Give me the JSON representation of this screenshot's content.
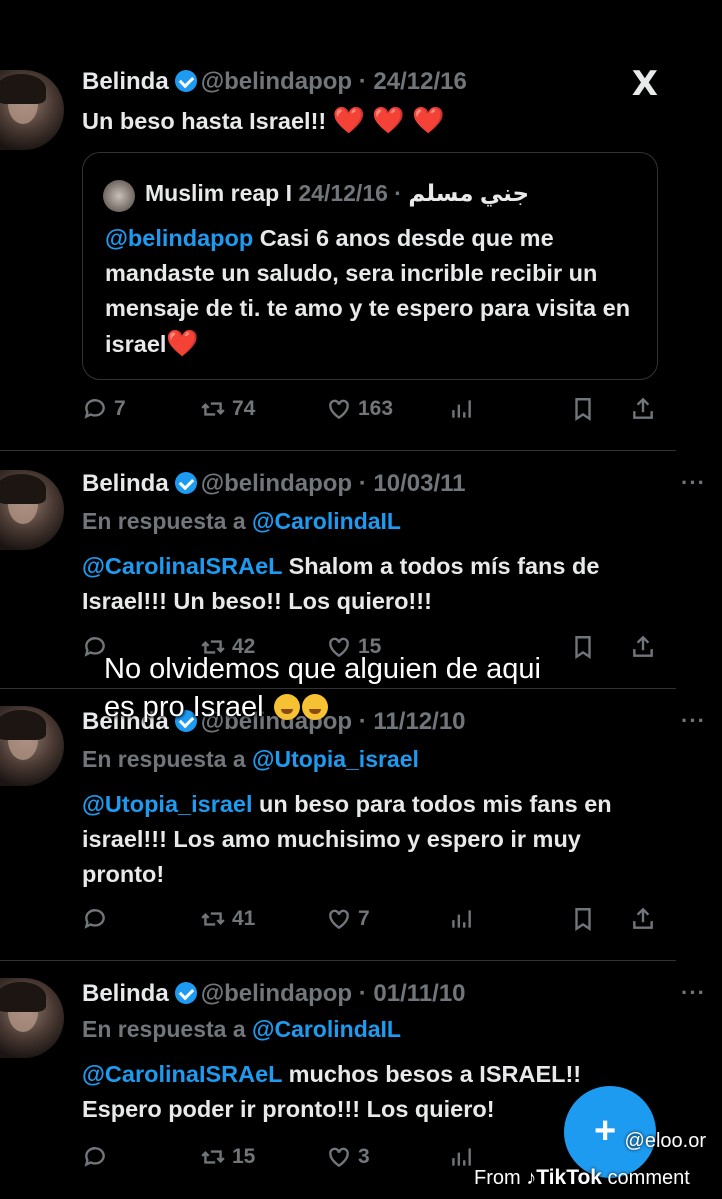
{
  "app": {
    "logo": "X"
  },
  "tweets": [
    {
      "name": "Belinda",
      "handle": "@belindapop",
      "date": "24/12/16",
      "text": "Un beso hasta Israel!!",
      "quote": {
        "name": "Muslim reap I جني مسلم",
        "date": "24/12/16",
        "mention": "@belindapop",
        "text": " Casi 6 anos desde que me mandaste un saludo, sera incrible recibir un mensaje de ti. te amo y te espero para visita en israel"
      },
      "stats": {
        "replies": "7",
        "retweets": "74",
        "likes": "163"
      }
    },
    {
      "name": "Belinda",
      "handle": "@belindapop",
      "date": "10/03/11",
      "reply_prefix": "En respuesta a ",
      "reply_to": "@CarolindaIL",
      "mention": "@CarolinaISRAeL",
      "text": " Shalom a todos mís fans de Israel!!! Un beso!! Los quiero!!!",
      "stats": {
        "replies": "",
        "retweets": "42",
        "likes": "15"
      }
    },
    {
      "name": "Belinda",
      "handle": "@belindapop",
      "date": "11/12/10",
      "reply_prefix": "En respuesta a ",
      "reply_to": "@Utopia_israel",
      "mention": "@Utopia_israel",
      "text": " un beso para todos mis fans en israel!!! Los amo muchisimo y espero ir muy pronto!",
      "stats": {
        "replies": "",
        "retweets": "41",
        "likes": "7"
      }
    },
    {
      "name": "Belinda",
      "handle": "@belindapop",
      "date": "01/11/10",
      "reply_prefix": "En respuesta a ",
      "reply_to": "@CarolindaIL",
      "mention": "@CarolinaISRAeL",
      "text": " muchos besos a ISRAEL!! Espero poder ir pronto!!! Los quiero!",
      "stats": {
        "replies": "",
        "retweets": "15",
        "likes": "3"
      }
    }
  ],
  "overlay": {
    "caption": "No olvidemos que alguien de aqui es pro Israel",
    "emoji_names": [
      "shushing-face-emoji",
      "hand-over-mouth-emoji"
    ]
  },
  "watermark": {
    "user": "@eloo.or",
    "from": "From",
    "brand": "TikTok",
    "suffix": "comment"
  },
  "colors": {
    "accent": "#1d9bf0",
    "muted": "#71767b",
    "heart": "#e8112d",
    "background": "#000000"
  }
}
